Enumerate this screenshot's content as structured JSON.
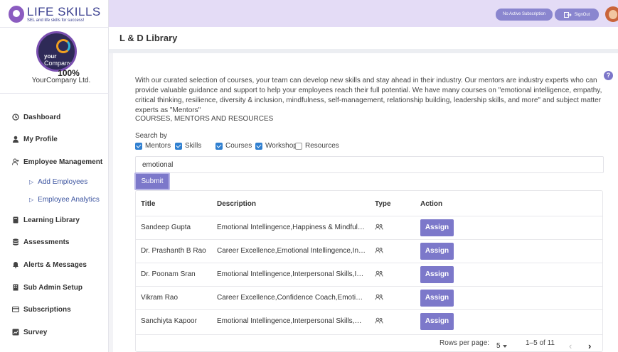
{
  "brand": {
    "name": "LIFE SKILLS",
    "tagline": "SEL and life skills for success!"
  },
  "company": {
    "logo_your": "your",
    "logo_company": "Company",
    "percent": "100%",
    "name": "YourCompany Ltd."
  },
  "sidebar": {
    "items": [
      {
        "label": "Dashboard",
        "icon": "clock-icon"
      },
      {
        "label": "My Profile",
        "icon": "user-icon"
      },
      {
        "label": "Employee Management",
        "icon": "user-plus-icon"
      },
      {
        "label": "Learning Library",
        "icon": "book-icon"
      },
      {
        "label": "Assessments",
        "icon": "database-icon"
      },
      {
        "label": "Alerts & Messages",
        "icon": "bell-icon"
      },
      {
        "label": "Sub Admin Setup",
        "icon": "building-icon"
      },
      {
        "label": "Subscriptions",
        "icon": "card-icon"
      },
      {
        "label": "Survey",
        "icon": "chart-icon"
      }
    ],
    "subitems": [
      {
        "label": "Add Employees"
      },
      {
        "label": "Employee Analytics"
      }
    ]
  },
  "header": {
    "subscription_label": "No Active Subscription",
    "signout_label": "SignOut"
  },
  "page": {
    "title": "L & D Library",
    "help": "?",
    "intro": "With our curated selection of courses, your team can develop new skills and stay ahead in their industry. Our mentors are industry experts who can provide valuable guidance and support to help your employees reach their full potential. We have many courses on \"emotional intelligence, empathy, critical thinking, resilience, diversity & inclusion, mindfulness, self-management, relationship building, leadership skills, and more\" and subject matter experts as \"Mentors\"",
    "section_title": "COURSES, MENTORS AND RESOURCES",
    "search_by": "Search by",
    "filters": [
      {
        "label": "Mentors",
        "checked": true
      },
      {
        "label": "Skills",
        "checked": true
      },
      {
        "label": "Courses",
        "checked": true
      },
      {
        "label": "Workshop",
        "checked": true
      },
      {
        "label": "Resources",
        "checked": false
      }
    ],
    "search_value": "emotional",
    "submit_label": "Submit"
  },
  "table": {
    "columns": [
      "Title",
      "Description",
      "Type",
      "Action"
    ],
    "rows": [
      {
        "title": "Sandeep Gupta",
        "description": "Emotional Intellingence,Happiness & Mindfulness",
        "action": "Assign"
      },
      {
        "title": "Dr. Prashanth B Rao",
        "description": "Career Excellence,Emotional Intellingence,Interpersonal Skills",
        "action": "Assign"
      },
      {
        "title": "Dr. Poonam Sran",
        "description": "Emotional Intellingence,Interpersonal Skills,Intrapersonal",
        "action": "Assign"
      },
      {
        "title": "Vikram Rao",
        "description": "Career Excellence,Confidence Coach,Emotional Intellingence",
        "action": "Assign"
      },
      {
        "title": "Sanchiyta Kapoor",
        "description": "Emotional Intellingence,Interpersonal Skills,Happiness",
        "action": "Assign"
      }
    ],
    "rows_per_page_label": "Rows per page:",
    "rows_per_page": "5",
    "range": "1–5 of 11"
  },
  "colors": {
    "accent": "#7c78ca",
    "header_bg": "#e4dcf6",
    "checkbox": "#2f7fd0",
    "link": "#3d55a0"
  }
}
